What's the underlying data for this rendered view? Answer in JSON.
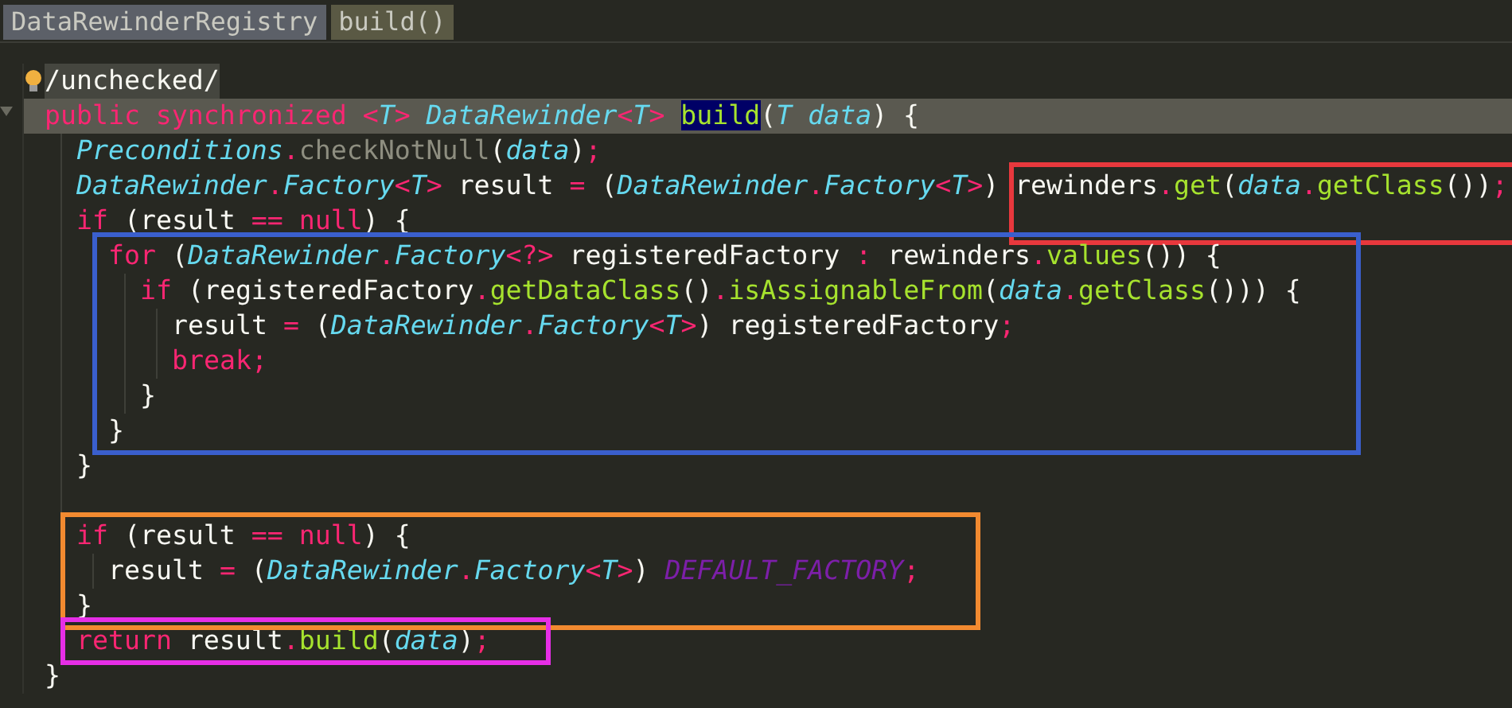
{
  "breadcrumbs": [
    {
      "kind": "class",
      "label": "DataRewinderRegistry"
    },
    {
      "kind": "method",
      "label": "build()"
    }
  ],
  "code": [
    {
      "kind": "annotation",
      "hint": true,
      "tokens": [
        {
          "kind": "plain",
          "text": "/unchecked/"
        }
      ]
    },
    {
      "kind": "line",
      "current": true,
      "close": "}",
      "tokens": [
        {
          "kind": "keyword",
          "text": "public synchronized "
        },
        {
          "kind": "op",
          "text": "<"
        },
        {
          "kind": "type",
          "text": "T"
        },
        {
          "kind": "op",
          "text": "> "
        },
        {
          "kind": "type",
          "text": "DataRewinder"
        },
        {
          "kind": "op",
          "text": "<"
        },
        {
          "kind": "type",
          "text": "T"
        },
        {
          "kind": "op",
          "text": "> "
        },
        {
          "kind": "method",
          "text": "build",
          "matched": true
        },
        {
          "kind": "plain",
          "text": "("
        },
        {
          "kind": "param",
          "text": "T data"
        },
        {
          "kind": "plain",
          "text": ") {"
        }
      ],
      "children": [
        {
          "kind": "line",
          "tokens": [
            {
              "kind": "type",
              "text": "Preconditions"
            },
            {
              "kind": "op",
              "text": "."
            },
            {
              "kind": "dim",
              "text": "checkNotNull"
            },
            {
              "kind": "plain",
              "text": "("
            },
            {
              "kind": "param",
              "text": "data"
            },
            {
              "kind": "plain",
              "text": ")"
            },
            {
              "kind": "op",
              "text": ";"
            }
          ]
        },
        {
          "kind": "line",
          "tokens": [
            {
              "kind": "type",
              "text": "DataRewinder"
            },
            {
              "kind": "op",
              "text": "."
            },
            {
              "kind": "type",
              "text": "Factory"
            },
            {
              "kind": "op",
              "text": "<"
            },
            {
              "kind": "type",
              "text": "T"
            },
            {
              "kind": "op",
              "text": ">"
            },
            {
              "kind": "plain",
              "text": " result "
            },
            {
              "kind": "op",
              "text": "="
            },
            {
              "kind": "plain",
              "text": " ("
            },
            {
              "kind": "type",
              "text": "DataRewinder"
            },
            {
              "kind": "op",
              "text": "."
            },
            {
              "kind": "type",
              "text": "Factory"
            },
            {
              "kind": "op",
              "text": "<"
            },
            {
              "kind": "type",
              "text": "T"
            },
            {
              "kind": "op",
              "text": ">"
            },
            {
              "kind": "plain",
              "text": ") "
            }
          ],
          "framed": {
            "color": "#e8383d",
            "tokens": [
              {
                "kind": "plain",
                "text": "rewinders"
              },
              {
                "kind": "op",
                "text": "."
              },
              {
                "kind": "method",
                "text": "get"
              },
              {
                "kind": "plain",
                "text": "("
              },
              {
                "kind": "param",
                "text": "data"
              },
              {
                "kind": "op",
                "text": "."
              },
              {
                "kind": "method",
                "text": "getClass"
              },
              {
                "kind": "plain",
                "text": "())"
              },
              {
                "kind": "op",
                "text": ";"
              }
            ]
          }
        },
        {
          "kind": "line",
          "close": "}",
          "tokens": [
            {
              "kind": "keyword",
              "text": "if"
            },
            {
              "kind": "plain",
              "text": " (result "
            },
            {
              "kind": "op",
              "text": "== "
            },
            {
              "kind": "keyword",
              "text": "null"
            },
            {
              "kind": "plain",
              "text": ") {"
            }
          ],
          "children": [
            {
              "kind": "line",
              "color": "#3a5fcd",
              "close": "}",
              "tokens": [
                {
                  "kind": "keyword",
                  "text": "for"
                },
                {
                  "kind": "plain",
                  "text": " ("
                },
                {
                  "kind": "type",
                  "text": "DataRewinder"
                },
                {
                  "kind": "op",
                  "text": "."
                },
                {
                  "kind": "type",
                  "text": "Factory"
                },
                {
                  "kind": "op",
                  "text": "<?>"
                },
                {
                  "kind": "plain",
                  "text": " registeredFactory "
                },
                {
                  "kind": "op",
                  "text": ":"
                },
                {
                  "kind": "plain",
                  "text": " rewinders"
                },
                {
                  "kind": "op",
                  "text": "."
                },
                {
                  "kind": "method",
                  "text": "values"
                },
                {
                  "kind": "plain",
                  "text": "()) {"
                }
              ],
              "children": [
                {
                  "kind": "line",
                  "close": "}",
                  "tokens": [
                    {
                      "kind": "keyword",
                      "text": "if"
                    },
                    {
                      "kind": "plain",
                      "text": " (registeredFactory"
                    },
                    {
                      "kind": "op",
                      "text": "."
                    },
                    {
                      "kind": "method",
                      "text": "getDataClass"
                    },
                    {
                      "kind": "plain",
                      "text": "()"
                    },
                    {
                      "kind": "op",
                      "text": "."
                    },
                    {
                      "kind": "method",
                      "text": "isAssignableFrom"
                    },
                    {
                      "kind": "plain",
                      "text": "("
                    },
                    {
                      "kind": "param",
                      "text": "data"
                    },
                    {
                      "kind": "op",
                      "text": "."
                    },
                    {
                      "kind": "method",
                      "text": "getClass"
                    },
                    {
                      "kind": "plain",
                      "text": "())) {"
                    }
                  ],
                  "children": [
                    {
                      "kind": "line",
                      "tokens": [
                        {
                          "kind": "plain",
                          "text": "result "
                        },
                        {
                          "kind": "op",
                          "text": "="
                        },
                        {
                          "kind": "plain",
                          "text": " ("
                        },
                        {
                          "kind": "type",
                          "text": "DataRewinder"
                        },
                        {
                          "kind": "op",
                          "text": "."
                        },
                        {
                          "kind": "type",
                          "text": "Factory"
                        },
                        {
                          "kind": "op",
                          "text": "<"
                        },
                        {
                          "kind": "type",
                          "text": "T"
                        },
                        {
                          "kind": "op",
                          "text": ">"
                        },
                        {
                          "kind": "plain",
                          "text": ") registeredFactory"
                        },
                        {
                          "kind": "op",
                          "text": ";"
                        }
                      ]
                    },
                    {
                      "kind": "line",
                      "tokens": [
                        {
                          "kind": "keyword",
                          "text": "break"
                        },
                        {
                          "kind": "op",
                          "text": ";"
                        }
                      ]
                    }
                  ]
                }
              ]
            }
          ]
        },
        {
          "kind": "blank"
        },
        {
          "kind": "line",
          "color": "#f28a30",
          "close": "}",
          "tokens": [
            {
              "kind": "keyword",
              "text": "if"
            },
            {
              "kind": "plain",
              "text": " (result "
            },
            {
              "kind": "op",
              "text": "== "
            },
            {
              "kind": "keyword",
              "text": "null"
            },
            {
              "kind": "plain",
              "text": ") {"
            }
          ],
          "children": [
            {
              "kind": "line",
              "tokens": [
                {
                  "kind": "plain",
                  "text": "result "
                },
                {
                  "kind": "op",
                  "text": "="
                },
                {
                  "kind": "plain",
                  "text": " ("
                },
                {
                  "kind": "type",
                  "text": "DataRewinder"
                },
                {
                  "kind": "op",
                  "text": "."
                },
                {
                  "kind": "type",
                  "text": "Factory"
                },
                {
                  "kind": "op",
                  "text": "<"
                },
                {
                  "kind": "type",
                  "text": "T"
                },
                {
                  "kind": "op",
                  "text": ">"
                },
                {
                  "kind": "plain",
                  "text": ") "
                },
                {
                  "kind": "constant",
                  "text": "DEFAULT_FACTORY"
                },
                {
                  "kind": "op",
                  "text": ";"
                }
              ]
            }
          ]
        },
        {
          "kind": "line",
          "color": "#e62ee6",
          "tokens": [
            {
              "kind": "keyword",
              "text": "return"
            },
            {
              "kind": "plain",
              "text": " result"
            },
            {
              "kind": "op",
              "text": "."
            },
            {
              "kind": "method",
              "text": "build"
            },
            {
              "kind": "plain",
              "text": "("
            },
            {
              "kind": "param",
              "text": "data"
            },
            {
              "kind": "plain",
              "text": ")"
            },
            {
              "kind": "op",
              "text": ";"
            }
          ]
        }
      ]
    }
  ]
}
